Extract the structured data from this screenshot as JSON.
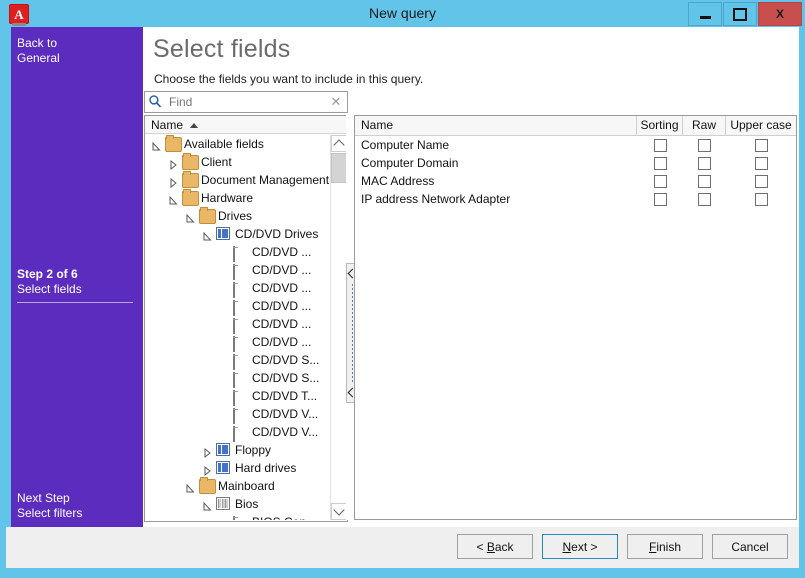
{
  "window": {
    "title": "New query",
    "app_icon": "letter-a-icon",
    "controls": {
      "minimize": "minimize-icon",
      "maximize": "maximize-icon",
      "close": "X"
    }
  },
  "sidebar": {
    "back_link_line1": "Back to",
    "back_link_line2": "General",
    "current_step_title": "Step 2 of 6",
    "current_step_name": "Select fields",
    "next_step_title": "Next Step",
    "next_step_name": "Select filters",
    "color": "#5b2cbd"
  },
  "page": {
    "title": "Select fields",
    "subtitle": "Choose the fields you want to include in this query."
  },
  "search": {
    "value": "",
    "placeholder": "Find",
    "icon": "search-icon",
    "clear_icon": "clear-icon"
  },
  "tree": {
    "header": "Name",
    "sort_direction": "ascending",
    "items": [
      {
        "label": "Available fields",
        "indent": 0,
        "icon": "folder",
        "state": "open"
      },
      {
        "label": "Client",
        "indent": 1,
        "icon": "folder",
        "state": "collapsed"
      },
      {
        "label": "Document Management",
        "indent": 1,
        "icon": "folder",
        "state": "collapsed"
      },
      {
        "label": "Hardware",
        "indent": 1,
        "icon": "folder",
        "state": "open"
      },
      {
        "label": "Drives",
        "indent": 2,
        "icon": "folder",
        "state": "open"
      },
      {
        "label": "CD/DVD Drives",
        "indent": 3,
        "icon": "table-blue",
        "state": "open"
      },
      {
        "label": "CD/DVD ...",
        "indent": 4,
        "icon": "field",
        "state": "leaf"
      },
      {
        "label": "CD/DVD ...",
        "indent": 4,
        "icon": "field",
        "state": "leaf"
      },
      {
        "label": "CD/DVD ...",
        "indent": 4,
        "icon": "field",
        "state": "leaf"
      },
      {
        "label": "CD/DVD ...",
        "indent": 4,
        "icon": "field",
        "state": "leaf"
      },
      {
        "label": "CD/DVD ...",
        "indent": 4,
        "icon": "field",
        "state": "leaf"
      },
      {
        "label": "CD/DVD ...",
        "indent": 4,
        "icon": "field",
        "state": "leaf"
      },
      {
        "label": "CD/DVD S...",
        "indent": 4,
        "icon": "field",
        "state": "leaf"
      },
      {
        "label": "CD/DVD S...",
        "indent": 4,
        "icon": "field",
        "state": "leaf"
      },
      {
        "label": "CD/DVD T...",
        "indent": 4,
        "icon": "field",
        "state": "leaf"
      },
      {
        "label": "CD/DVD V...",
        "indent": 4,
        "icon": "field",
        "state": "leaf"
      },
      {
        "label": "CD/DVD V...",
        "indent": 4,
        "icon": "field",
        "state": "leaf"
      },
      {
        "label": "Floppy",
        "indent": 3,
        "icon": "table-blue",
        "state": "collapsed"
      },
      {
        "label": "Hard drives",
        "indent": 3,
        "icon": "table-blue",
        "state": "collapsed"
      },
      {
        "label": "Mainboard",
        "indent": 2,
        "icon": "folder",
        "state": "open"
      },
      {
        "label": "Bios",
        "indent": 3,
        "icon": "table-gray",
        "state": "open"
      },
      {
        "label": "BIOS Con...",
        "indent": 4,
        "icon": "field",
        "state": "leaf"
      }
    ]
  },
  "splitter": {
    "name": "panel-splitter"
  },
  "grid": {
    "columns": [
      "Name",
      "Sorting",
      "Raw",
      "Upper case"
    ],
    "rows": [
      {
        "name": "Computer Name",
        "sorting": false,
        "raw": false,
        "upper_case": false
      },
      {
        "name": "Computer Domain",
        "sorting": false,
        "raw": false,
        "upper_case": false
      },
      {
        "name": "MAC Address",
        "sorting": false,
        "raw": false,
        "upper_case": false
      },
      {
        "name": "IP address Network Adapter",
        "sorting": false,
        "raw": false,
        "upper_case": false
      }
    ]
  },
  "footer": {
    "back": "< Back",
    "back_prefix": "< ",
    "back_accel": "B",
    "back_rest": "ack",
    "next_accel": "N",
    "next_rest": "ext >",
    "finish_accel": "F",
    "finish_rest": "inish",
    "cancel": "Cancel"
  }
}
